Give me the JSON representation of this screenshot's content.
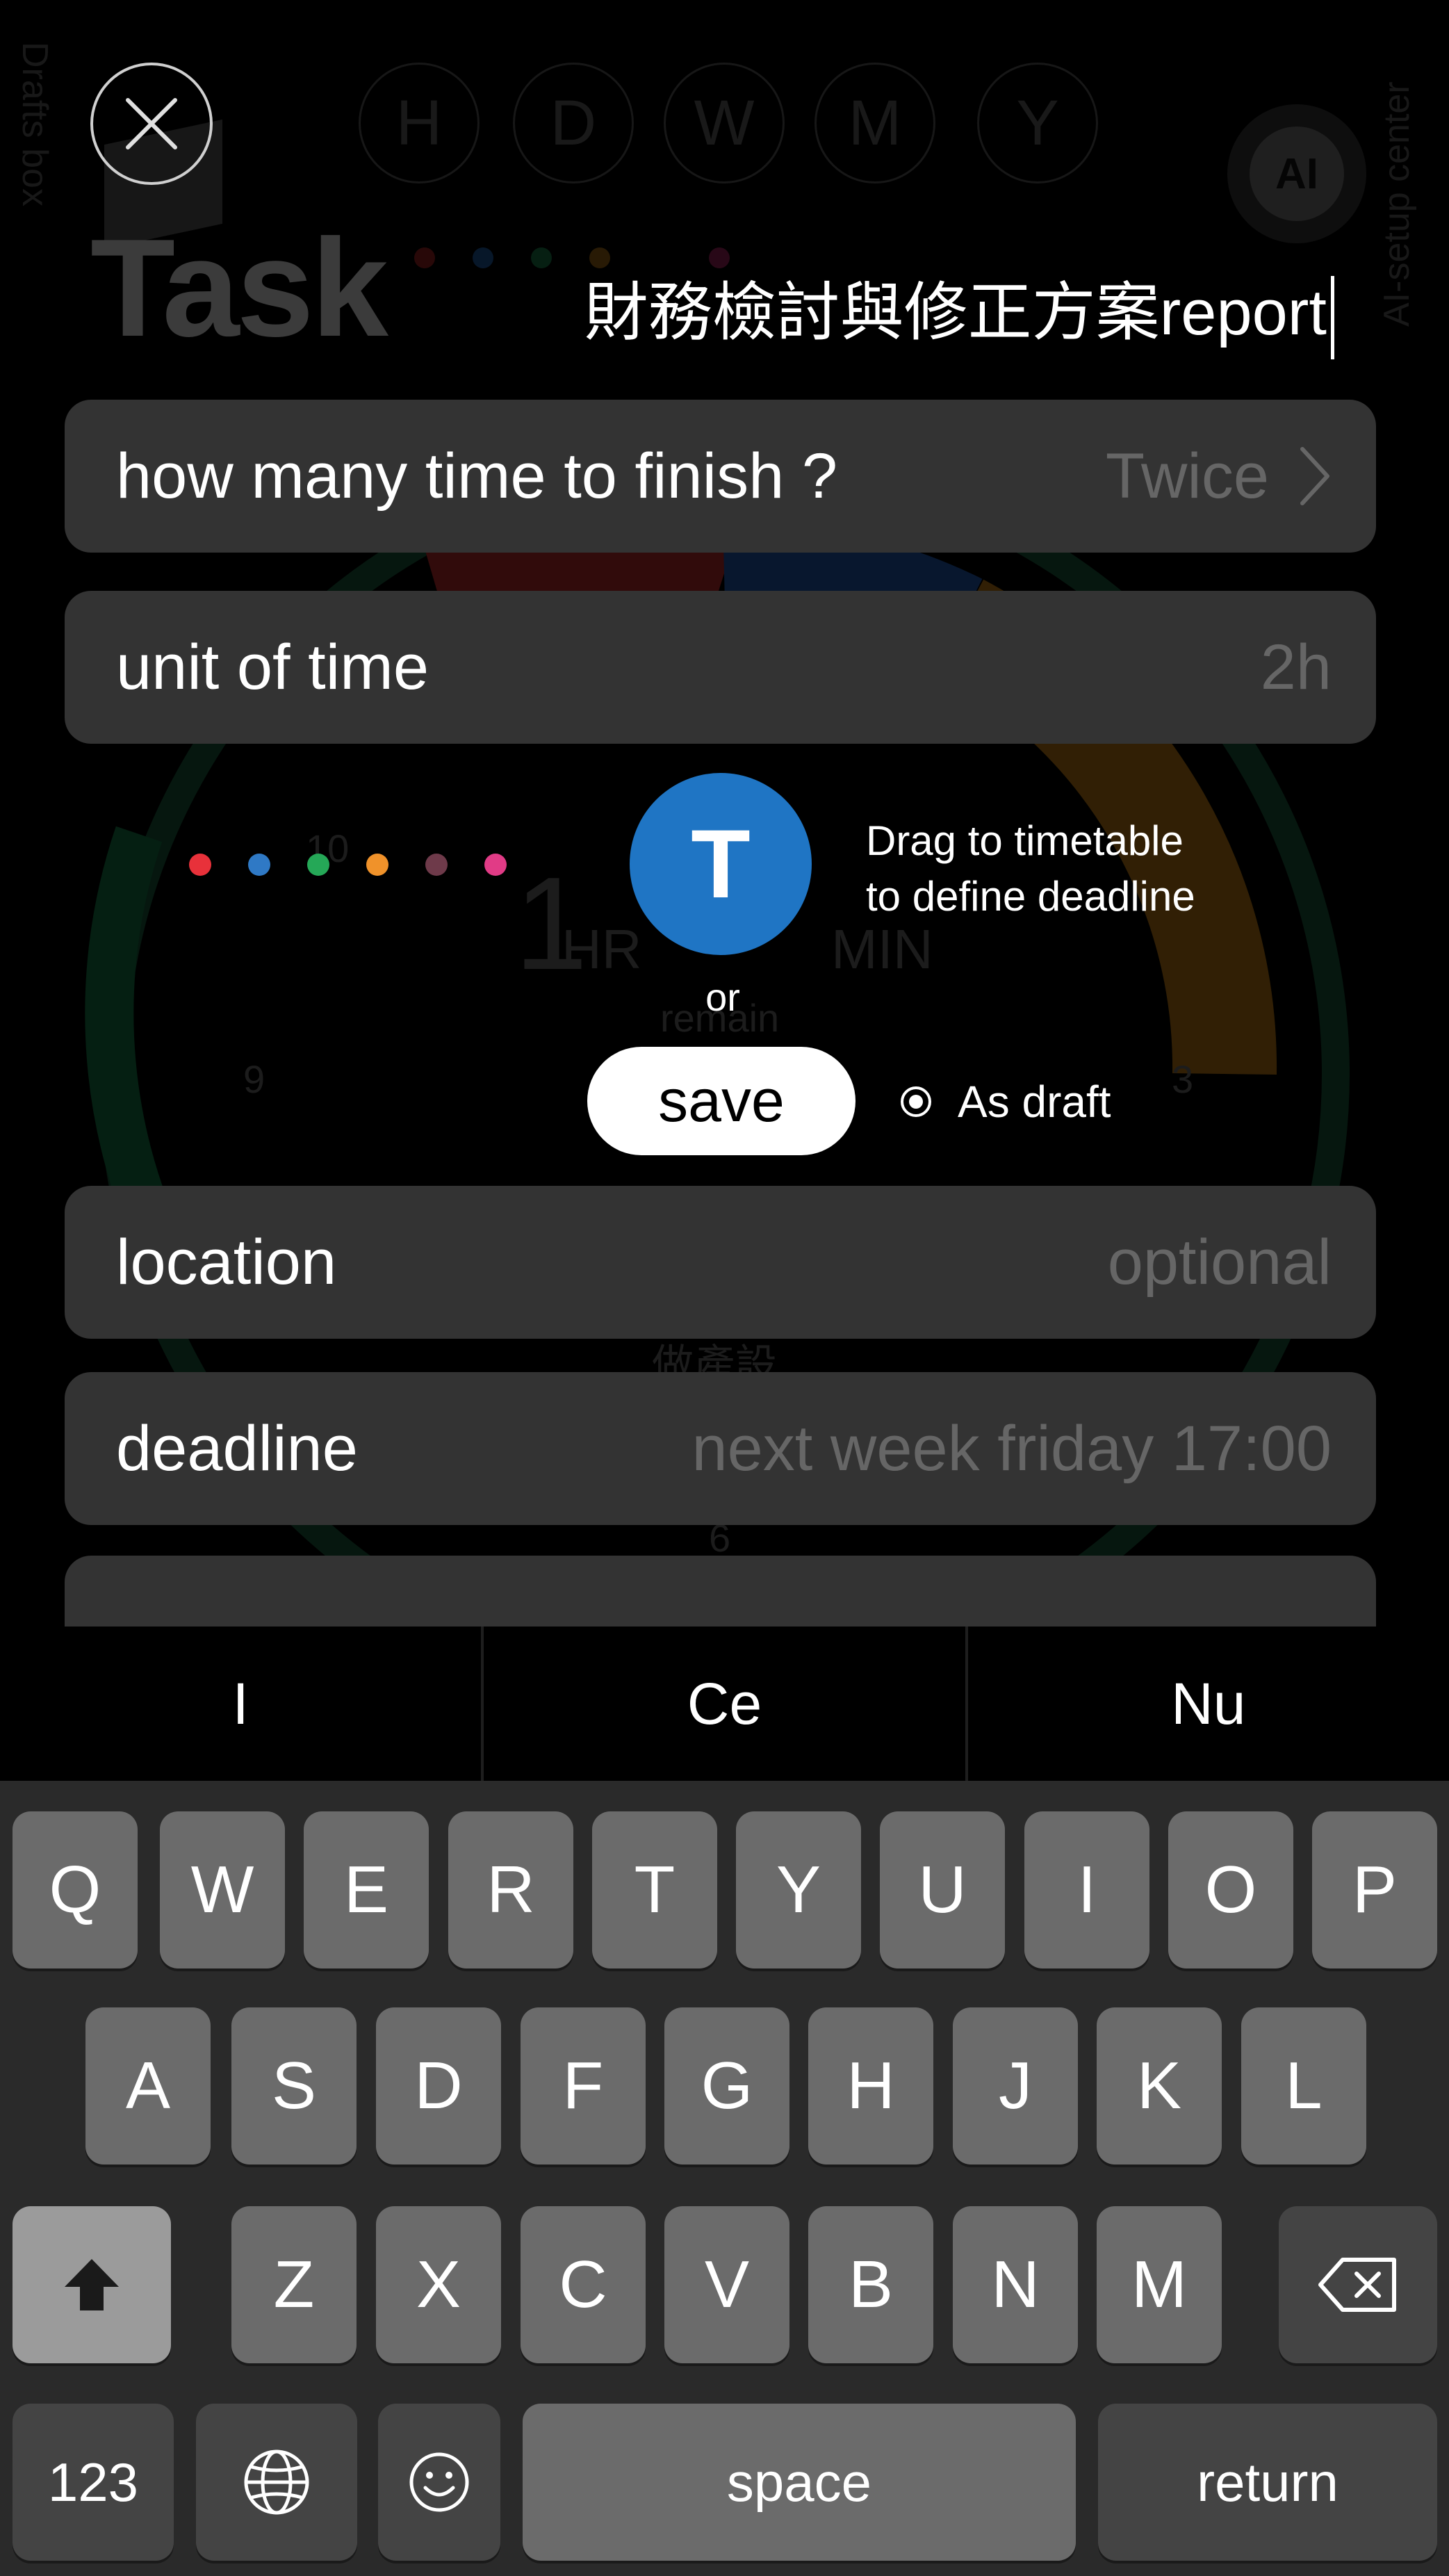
{
  "background": {
    "periods": [
      "H",
      "D",
      "W",
      "M",
      "Y"
    ],
    "drafts_box": "Drafts box",
    "ai_setup_center": "AI-setup center",
    "ai_badge": "AI",
    "title": "Task",
    "clock": {
      "hr_digit": "1",
      "hr": "HR",
      "min": "MIN",
      "remain": "remain",
      "nine": "9",
      "three": "3",
      "six": "6",
      "ten": "10",
      "bottom_label": "做產設"
    }
  },
  "task_title": {
    "value": "財務檢討與修正方案report"
  },
  "form": {
    "times": {
      "label": "how many time to finish ?",
      "value": "Twice"
    },
    "unit": {
      "label": "unit of time",
      "value": "2h"
    },
    "location": {
      "label": "location",
      "placeholder": "optional"
    },
    "deadline": {
      "label": "deadline",
      "placeholder": "next week friday 17:00"
    }
  },
  "deadline_picker": {
    "colors": [
      "#e8313a",
      "#2f79c5",
      "#25a857",
      "#f0922a",
      "#6e3a4a",
      "#e13b86"
    ],
    "drag_button": "T",
    "hint_line1": "Drag to timetable",
    "hint_line2": "to define deadline",
    "or": "or",
    "save": "save",
    "as_draft": "As draft",
    "as_draft_selected": true
  },
  "keyboard": {
    "suggestions": [
      "I",
      "Ce",
      "Nu"
    ],
    "row1": [
      "Q",
      "W",
      "E",
      "R",
      "T",
      "Y",
      "U",
      "I",
      "O",
      "P"
    ],
    "row2": [
      "A",
      "S",
      "D",
      "F",
      "G",
      "H",
      "J",
      "K",
      "L"
    ],
    "row3": [
      "Z",
      "X",
      "C",
      "V",
      "B",
      "N",
      "M"
    ],
    "numbers": "123",
    "space": "space",
    "return": "return"
  }
}
